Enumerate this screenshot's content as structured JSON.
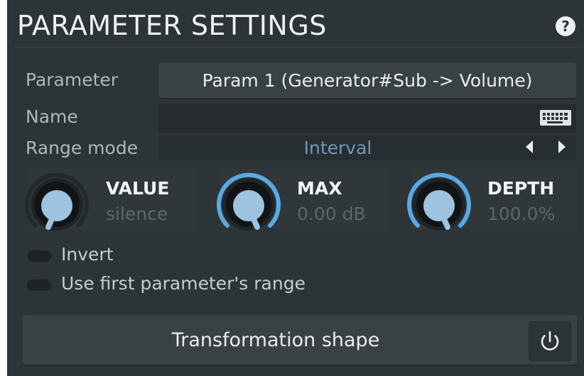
{
  "title": "PARAMETER SETTINGS",
  "help_label": "?",
  "fields": {
    "parameter_label": "Parameter",
    "parameter_value": "Param 1 (Generator#Sub -> Volume)",
    "name_label": "Name",
    "name_value": "",
    "range_mode_label": "Range mode",
    "range_mode_value": "Interval"
  },
  "knobs": {
    "value": {
      "label": "VALUE",
      "display": "silence"
    },
    "max": {
      "label": "MAX",
      "display": "0.00 dB"
    },
    "depth": {
      "label": "DEPTH",
      "display": "100.0%"
    }
  },
  "toggles": {
    "invert_label": "Invert",
    "use_first_label": "Use first parameter's range"
  },
  "transformation_shape_label": "Transformation shape",
  "icons": {
    "help": "question-icon",
    "keyboard": "keyboard-icon",
    "prev": "arrow-left-icon",
    "next": "arrow-right-icon",
    "power": "power-icon"
  },
  "colors": {
    "accent": "#5aa9e6",
    "knob_cap": "#9ec3df",
    "range_value": "#6e9ab8"
  }
}
